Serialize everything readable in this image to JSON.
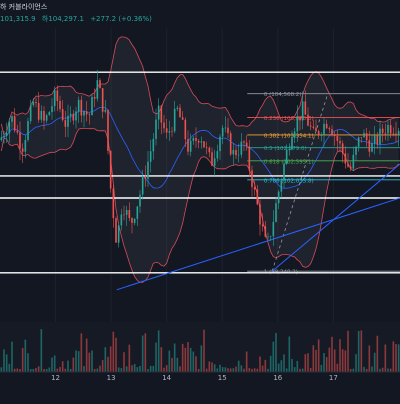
{
  "header": {
    "title": "하 커블라이언스",
    "ohlc_values": [
      "101,315.9",
      "하104,297.1",
      "+277.2 (+0.36%)"
    ]
  },
  "colors": {
    "background": "#131722",
    "up": "#26a69a",
    "down": "#ef5350",
    "bollinger": "#d64b5a",
    "trendline": "#2962ff",
    "horizontal_line": "#ffffff"
  },
  "chart_data": {
    "type": "candlestick",
    "x_ticks": [
      "12",
      "13",
      "14",
      "15",
      "16",
      "17"
    ],
    "ylim": [
      98500,
      106500
    ],
    "price": [
      {
        "x": 11.0,
        "y": 103200
      },
      {
        "x": 11.2,
        "y": 103900
      },
      {
        "x": 11.4,
        "y": 103000
      },
      {
        "x": 11.6,
        "y": 104300
      },
      {
        "x": 11.8,
        "y": 103700
      },
      {
        "x": 12.0,
        "y": 104500
      },
      {
        "x": 12.2,
        "y": 103600
      },
      {
        "x": 12.4,
        "y": 104300
      },
      {
        "x": 12.6,
        "y": 103900
      },
      {
        "x": 12.75,
        "y": 104900
      },
      {
        "x": 12.9,
        "y": 103900
      },
      {
        "x": 13.0,
        "y": 101600
      },
      {
        "x": 13.1,
        "y": 100200
      },
      {
        "x": 13.2,
        "y": 101400
      },
      {
        "x": 13.35,
        "y": 100700
      },
      {
        "x": 13.5,
        "y": 101500
      },
      {
        "x": 13.7,
        "y": 102800
      },
      {
        "x": 13.85,
        "y": 104000
      },
      {
        "x": 14.0,
        "y": 103300
      },
      {
        "x": 14.2,
        "y": 104100
      },
      {
        "x": 14.4,
        "y": 102900
      },
      {
        "x": 14.6,
        "y": 103400
      },
      {
        "x": 14.8,
        "y": 102500
      },
      {
        "x": 15.0,
        "y": 103600
      },
      {
        "x": 15.2,
        "y": 102800
      },
      {
        "x": 15.4,
        "y": 103100
      },
      {
        "x": 15.6,
        "y": 101500
      },
      {
        "x": 15.8,
        "y": 100000
      },
      {
        "x": 15.9,
        "y": 100700
      },
      {
        "x": 16.05,
        "y": 102000
      },
      {
        "x": 16.25,
        "y": 103500
      },
      {
        "x": 16.45,
        "y": 104100
      },
      {
        "x": 16.65,
        "y": 103300
      },
      {
        "x": 16.9,
        "y": 103800
      },
      {
        "x": 17.1,
        "y": 103100
      },
      {
        "x": 17.3,
        "y": 102300
      },
      {
        "x": 17.5,
        "y": 103400
      },
      {
        "x": 17.7,
        "y": 103000
      },
      {
        "x": 17.95,
        "y": 103600
      }
    ],
    "horizontal_levels": [
      105200,
      102150,
      101500,
      99300
    ],
    "fibonacci": {
      "levels": [
        {
          "label": "0 (104,568.2)",
          "value": 104568.2,
          "color": "#9598a1"
        },
        {
          "label": "0.236 (103,870.3)",
          "value": 103870.3,
          "color": "#ef5350"
        },
        {
          "label": "0.382 (103,354.1)",
          "value": 103354.1,
          "color": "#f2a33a"
        },
        {
          "label": "0.5 (102,979.0)",
          "value": 102979.0,
          "color": "#26a69a"
        },
        {
          "label": "0.618 (102,595.1)",
          "value": 102595.1,
          "color": "#4caf50"
        },
        {
          "label": "0.786 (102,035.8)",
          "value": 102035.8,
          "color": "#26c6da"
        },
        {
          "label": "1 (99,348.2)",
          "value": 99348.2,
          "color": "#9598a1"
        }
      ]
    },
    "trendlines": [
      {
        "x1": 13.1,
        "y1": 98800,
        "x2": 18.2,
        "y2": 101500
      },
      {
        "x1": 15.9,
        "y1": 99350,
        "x2": 18.2,
        "y2": 102500
      }
    ]
  }
}
